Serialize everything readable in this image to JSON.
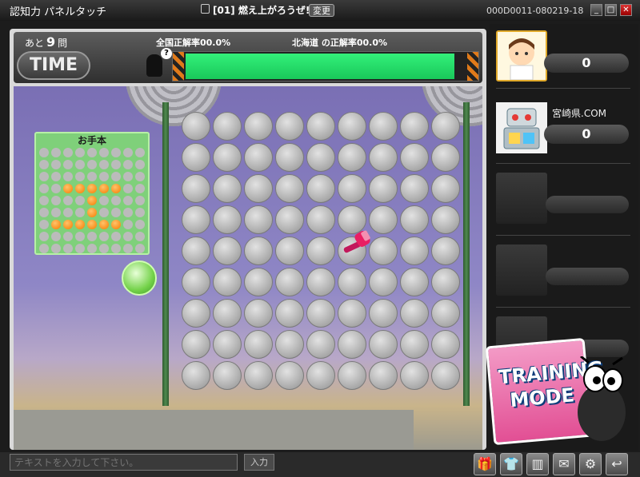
{
  "window": {
    "app_title": "認知力  パネルタッチ",
    "room": "[01] 燃え上がろうぜ!",
    "change_label": "変更",
    "session_id": "000D0011-080219-18",
    "min_label": "_",
    "max_label": "□",
    "close_label": "✕"
  },
  "hud": {
    "remaining_prefix": "あと",
    "remaining_count": "9",
    "remaining_suffix": "問",
    "national_rate": "全国正解率00.0%",
    "region_rate": "北海道  の正解率00.0%",
    "time_label": "TIME",
    "hint_label": "?",
    "time_fraction": 0.96
  },
  "model": {
    "title": "お手本",
    "rows": 9,
    "cols": 9,
    "on_cells": [
      [
        3,
        2
      ],
      [
        3,
        3
      ],
      [
        3,
        4
      ],
      [
        3,
        5
      ],
      [
        3,
        6
      ],
      [
        4,
        4
      ],
      [
        5,
        4
      ],
      [
        6,
        1
      ],
      [
        6,
        2
      ],
      [
        6,
        3
      ],
      [
        6,
        4
      ],
      [
        6,
        5
      ],
      [
        6,
        6
      ]
    ]
  },
  "board": {
    "rows": 9,
    "cols": 9
  },
  "players": [
    {
      "name": "",
      "score": "0",
      "icon": "boy-avatar-icon"
    },
    {
      "name": "宮崎県.COM",
      "score": "0",
      "icon": "robot-avatar-icon"
    }
  ],
  "training": {
    "line1": "TRAINING",
    "line2": "MODE"
  },
  "chat": {
    "placeholder": "テキストを入力して下さい。",
    "send_label": "入力"
  },
  "colors": {
    "accent_green": "#1fd86a",
    "model_on": "#f57c00",
    "training_pink": "#e24f94"
  }
}
